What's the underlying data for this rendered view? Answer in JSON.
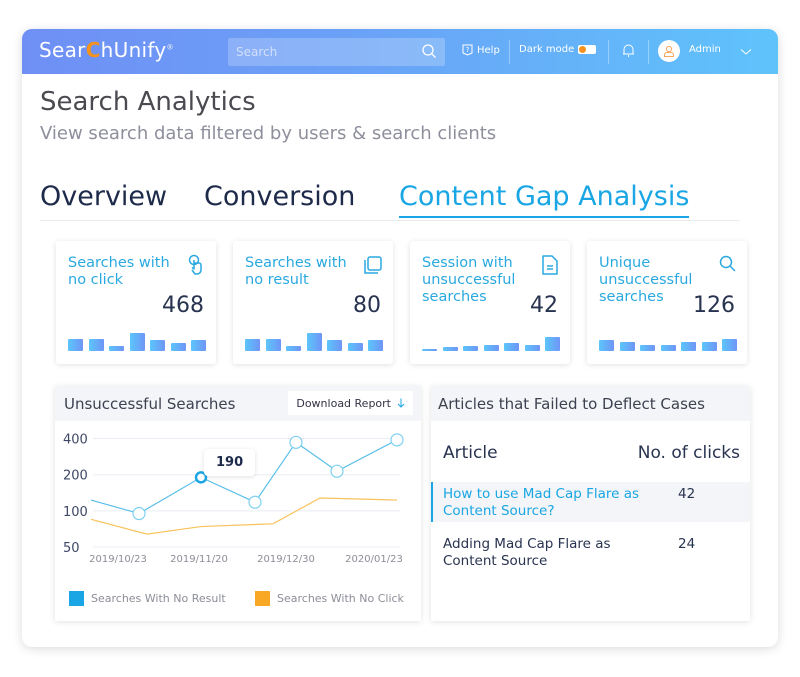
{
  "header": {
    "logo": {
      "before": "Sear",
      "accent": "C",
      "after": "hUnify",
      "mark": "®"
    },
    "search": {
      "placeholder": "Search",
      "value": "",
      "icon": "search-icon"
    },
    "help_label": "Help",
    "dark_mode_label": "Dark mode",
    "dark_mode_on": false,
    "notifications_icon": "bell-icon",
    "user_name": "Admin",
    "user_menu_icon": "chevron-down-icon"
  },
  "page": {
    "title": "Search Analytics",
    "subtitle": "View search data filtered by users & search clients"
  },
  "tabs": [
    {
      "label": "Overview",
      "active": false
    },
    {
      "label": "Conversion",
      "active": false
    },
    {
      "label": "Content Gap Analysis",
      "active": true
    }
  ],
  "cards": [
    {
      "label": "Searches with no click",
      "value": "468",
      "icon": "tap-icon",
      "bars": [
        0.5,
        0.5,
        0.22,
        0.75,
        0.45,
        0.35,
        0.45
      ]
    },
    {
      "label": "Searches with no result",
      "value": "80",
      "icon": "copy-icon",
      "bars": [
        0.5,
        0.5,
        0.2,
        0.75,
        0.45,
        0.35,
        0.45
      ]
    },
    {
      "label": "Session with unsuccessful searches",
      "value": "42",
      "icon": "document-icon",
      "bars": [
        0.08,
        0.18,
        0.2,
        0.25,
        0.35,
        0.25,
        0.6
      ]
    },
    {
      "label": "Unique unsuccessful searches",
      "value": "126",
      "icon": "search-icon",
      "bars": [
        0.45,
        0.38,
        0.26,
        0.26,
        0.38,
        0.38,
        0.52
      ]
    }
  ],
  "unsuccessful_searches": {
    "title": "Unsuccessful Searches",
    "download_label": "Download Report",
    "tooltip_value": "190"
  },
  "chart_data": {
    "type": "line",
    "title": "Unsuccessful Searches",
    "xlabel": "",
    "ylabel": "",
    "y_scale": "log",
    "yticks": [
      50,
      100,
      200,
      400
    ],
    "ytick_labels": [
      "50",
      "100",
      "200",
      "400"
    ],
    "xtick_labels": [
      "2019/10/23",
      "2019/11/20",
      "2019/12/30",
      "2020/01/23"
    ],
    "grid": true,
    "legend_position": "bottom",
    "series": [
      {
        "name": "Searches With No Result",
        "color": "#1aa6e4",
        "values": [
          123,
          95,
          190,
          118,
          372,
          214,
          390
        ],
        "markers": [
          false,
          true,
          true,
          true,
          true,
          true,
          true
        ],
        "highlighted_index": 2
      },
      {
        "name": "Searches With No Click",
        "color": "#f9a825",
        "values": [
          85,
          64,
          74,
          78,
          128,
          123
        ],
        "markers": [
          false,
          false,
          false,
          false,
          false,
          false
        ]
      }
    ]
  },
  "articles_panel": {
    "title": "Articles that Failed to Deflect Cases",
    "columns": [
      "Article",
      "No. of clicks"
    ],
    "rows": [
      {
        "article": "How to use Mad Cap Flare as Content  Source?",
        "clicks": "42",
        "active": true
      },
      {
        "article": "Adding Mad Cap Flare as Content Source",
        "clicks": "24",
        "active": false
      }
    ]
  }
}
